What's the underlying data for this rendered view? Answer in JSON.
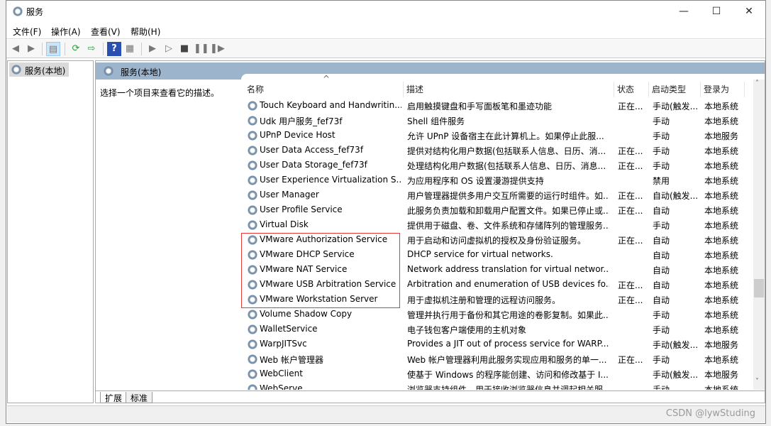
{
  "window": {
    "title": "服务",
    "minimize": "—",
    "maximize": "☐",
    "close": "✕"
  },
  "menu": [
    "文件(F)",
    "操作(A)",
    "查看(V)",
    "帮助(H)"
  ],
  "toolbar": {
    "icons": [
      "back-arrow-icon",
      "forward-arrow-icon",
      "show-hide-console-tree-icon",
      "refresh-icon",
      "export-list-icon",
      "help-icon",
      "properties-icon",
      "start-icon",
      "start-alt-icon",
      "stop-icon",
      "pause-icon",
      "resume-icon"
    ]
  },
  "tree": {
    "item": "服务(本地)"
  },
  "panel": {
    "title": "服务(本地)",
    "description": "选择一个项目来查看它的描述。"
  },
  "table": {
    "columns": [
      "名称",
      "描述",
      "状态",
      "启动类型",
      "登录为"
    ],
    "sort_indicator": "^",
    "rows": [
      [
        "Touch Keyboard and Handwritin...",
        "启用触摸键盘和手写面板笔和墨迹功能",
        "正在...",
        "手动(触发...",
        "本地系统"
      ],
      [
        "Udk 用户服务_fef73f",
        "Shell 组件服务",
        "",
        "手动",
        "本地系统"
      ],
      [
        "UPnP Device Host",
        "允许 UPnP 设备宿主在此计算机上。如果停止此服...",
        "",
        "手动",
        "本地服务"
      ],
      [
        "User Data Access_fef73f",
        "提供对结构化用户数据(包括联系人信息、日历、消...",
        "正在...",
        "手动",
        "本地系统"
      ],
      [
        "User Data Storage_fef73f",
        "处理结构化用户数据(包括联系人信息、日历、消息...",
        "正在...",
        "手动",
        "本地系统"
      ],
      [
        "User Experience Virtualization S...",
        "为应用程序和 OS 设置漫游提供支持",
        "",
        "禁用",
        "本地系统"
      ],
      [
        "User Manager",
        "用户管理器提供多用户交互所需要的运行时组件。如...",
        "正在...",
        "自动(触发...",
        "本地系统"
      ],
      [
        "User Profile Service",
        "此服务负责加载和卸载用户配置文件。如果已停止或...",
        "正在...",
        "自动",
        "本地系统"
      ],
      [
        "Virtual Disk",
        "提供用于磁盘、卷、文件系统和存储阵列的管理服务...",
        "",
        "手动",
        "本地系统"
      ],
      [
        "VMware Authorization Service",
        "用于启动和访问虚拟机的授权及身份验证服务。",
        "正在...",
        "自动",
        "本地系统"
      ],
      [
        "VMware DHCP Service",
        "DHCP service for virtual networks.",
        "",
        "自动",
        "本地系统"
      ],
      [
        "VMware NAT Service",
        "Network address translation for virtual networ...",
        "",
        "自动",
        "本地系统"
      ],
      [
        "VMware USB Arbitration Service",
        "Arbitration and enumeration of USB devices fo...",
        "正在...",
        "自动",
        "本地系统"
      ],
      [
        "VMware Workstation Server",
        "用于虚拟机注册和管理的远程访问服务。",
        "正在...",
        "自动",
        "本地系统"
      ],
      [
        "Volume Shadow Copy",
        "管理并执行用于备份和其它用途的卷影复制。如果此...",
        "",
        "手动",
        "本地系统"
      ],
      [
        "WalletService",
        "电子钱包客户端使用的主机对象",
        "",
        "手动",
        "本地系统"
      ],
      [
        "WarpJITSvc",
        "Provides a JIT out of process service for WARP...",
        "",
        "手动(触发...",
        "本地服务"
      ],
      [
        "Web 帐户管理器",
        "Web 帐户管理器利用此服务实现应用和服务的单一...",
        "正在...",
        "手动",
        "本地系统"
      ],
      [
        "WebClient",
        "使基于 Windows 的程序能创建、访问和修改基于 I...",
        "",
        "手动(触发...",
        "本地服务"
      ],
      [
        "WebServe",
        "浏览器支持组件，用于接收浏览器信息并调起相关服",
        "",
        "手动",
        "本地系统"
      ]
    ]
  },
  "tabs": [
    "扩展",
    "标准"
  ],
  "watermark": "CSDN @lywStuding",
  "highlight_color": "#e53935"
}
